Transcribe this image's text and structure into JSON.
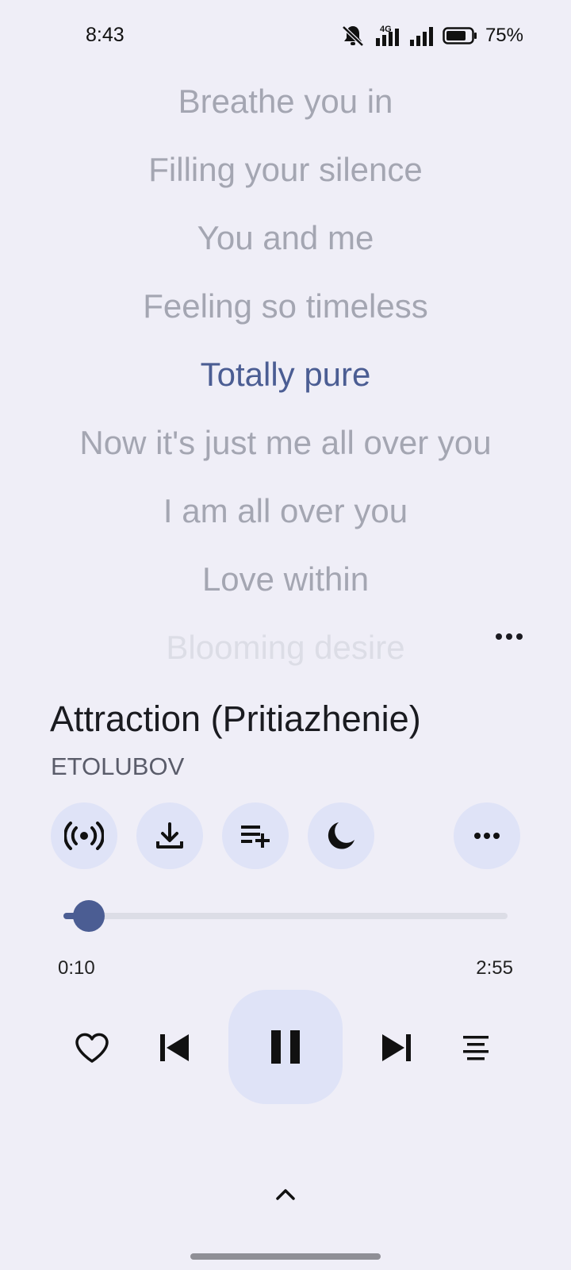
{
  "status_bar": {
    "time": "8:43",
    "network": "4G",
    "battery": "75%",
    "icons": [
      "mute-icon",
      "signal-4g-icon",
      "signal-icon",
      "battery-icon"
    ]
  },
  "lyrics": {
    "lines": [
      "Breathe you in",
      "Filling your silence",
      "You and me",
      "Feeling so timeless",
      "Totally pure",
      "Now it's just me all over you",
      "I am all over you",
      "Love within",
      "Blooming desire"
    ],
    "active_index": 4
  },
  "song": {
    "title": "Attraction (Pritiazhenie)",
    "artist": "ETOLUBOV"
  },
  "actions": [
    "radio-icon",
    "download-icon",
    "add-to-queue-icon",
    "sleep-timer-icon",
    "more-icon"
  ],
  "playback": {
    "elapsed": "0:10",
    "total": "2:55",
    "progress_fraction": 0.057
  },
  "controls": [
    "heart-icon",
    "previous-icon",
    "pause-icon",
    "next-icon",
    "lyrics-icon"
  ],
  "colors": {
    "background": "#efeef7",
    "accent": "#4b5d93",
    "button_bg": "#dfe3f7",
    "lyric_inactive": "#a4a6b2"
  }
}
